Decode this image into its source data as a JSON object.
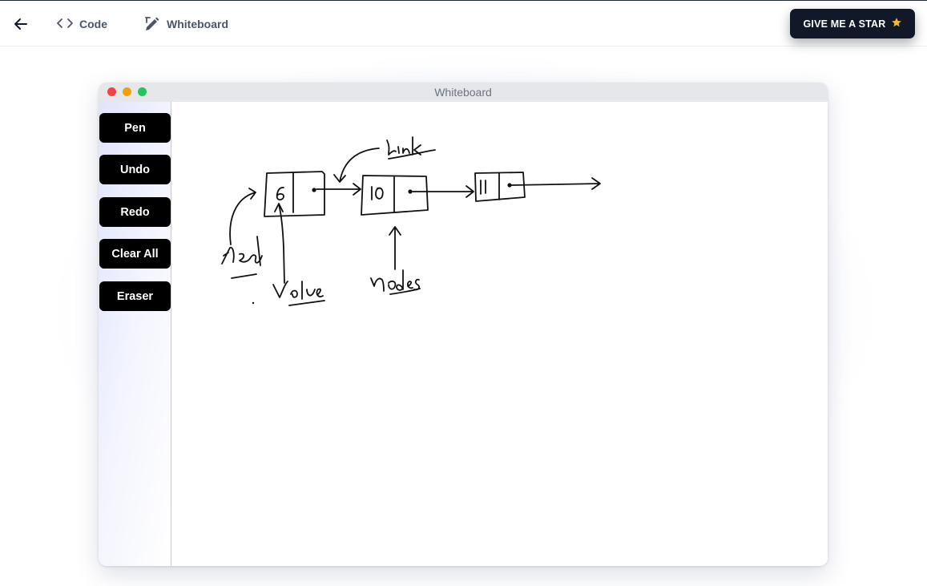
{
  "header": {
    "nav": [
      {
        "label": "Code",
        "icon": "code-icon"
      },
      {
        "label": "Whiteboard",
        "icon": "pencil-ruler-icon"
      }
    ],
    "star_button": {
      "label": "GIVE ME A STAR",
      "icon": "star-icon",
      "icon_color": "#f5b82e"
    }
  },
  "window": {
    "title": "Whiteboard"
  },
  "toolbar": {
    "buttons": [
      {
        "label": "Pen"
      },
      {
        "label": "Undo"
      },
      {
        "label": "Redo"
      },
      {
        "label": "Clear All"
      },
      {
        "label": "Eraser"
      }
    ]
  },
  "canvas": {
    "handwritten_labels": [
      "link",
      "head",
      "Value",
      "nodes"
    ],
    "node_values": [
      "6",
      "10",
      "11"
    ]
  }
}
